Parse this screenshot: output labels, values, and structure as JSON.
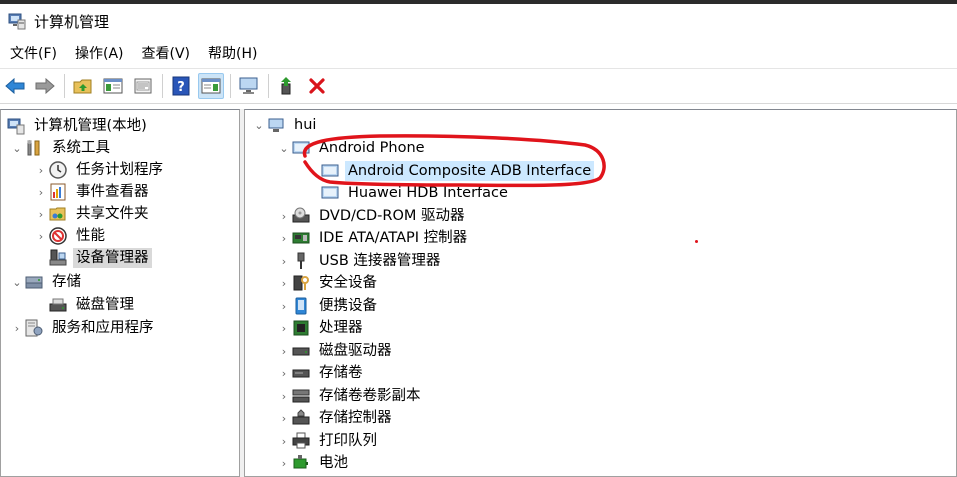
{
  "window": {
    "title": "计算机管理"
  },
  "menu": [
    {
      "label": "文件(F)"
    },
    {
      "label": "操作(A)"
    },
    {
      "label": "查看(V)"
    },
    {
      "label": "帮助(H)"
    }
  ],
  "toolbar": {
    "back": "back-arrow",
    "forward": "forward-arrow",
    "up": "up-folder",
    "show_tree": "show-hide-console-tree",
    "properties": "properties",
    "help": "help",
    "action_pane": "show-hide-action-pane",
    "scan": "scan-hardware-changes",
    "update_driver": "update-driver",
    "uninstall": "uninstall-device"
  },
  "left_tree": [
    {
      "label": "计算机管理(本地)"
    },
    {
      "label": "系统工具"
    },
    {
      "label": "任务计划程序"
    },
    {
      "label": "事件查看器"
    },
    {
      "label": "共享文件夹"
    },
    {
      "label": "性能"
    },
    {
      "label": "设备管理器"
    },
    {
      "label": "存储"
    },
    {
      "label": "磁盘管理"
    },
    {
      "label": "服务和应用程序"
    }
  ],
  "right_tree": [
    {
      "label": "hui"
    },
    {
      "label": "Android Phone"
    },
    {
      "label": "Android Composite ADB Interface"
    },
    {
      "label": "Huawei HDB Interface"
    },
    {
      "label": "DVD/CD-ROM 驱动器"
    },
    {
      "label": "IDE ATA/ATAPI 控制器"
    },
    {
      "label": "USB 连接器管理器"
    },
    {
      "label": "安全设备"
    },
    {
      "label": "便携设备"
    },
    {
      "label": "处理器"
    },
    {
      "label": "磁盘驱动器"
    },
    {
      "label": "存储卷"
    },
    {
      "label": "存储卷卷影副本"
    },
    {
      "label": "存储控制器"
    },
    {
      "label": "打印队列"
    },
    {
      "label": "电池"
    }
  ],
  "colors": {
    "annotation": "#e0141b",
    "selection_gray": "#d9d9d9",
    "selection_blue": "#cce8ff"
  }
}
